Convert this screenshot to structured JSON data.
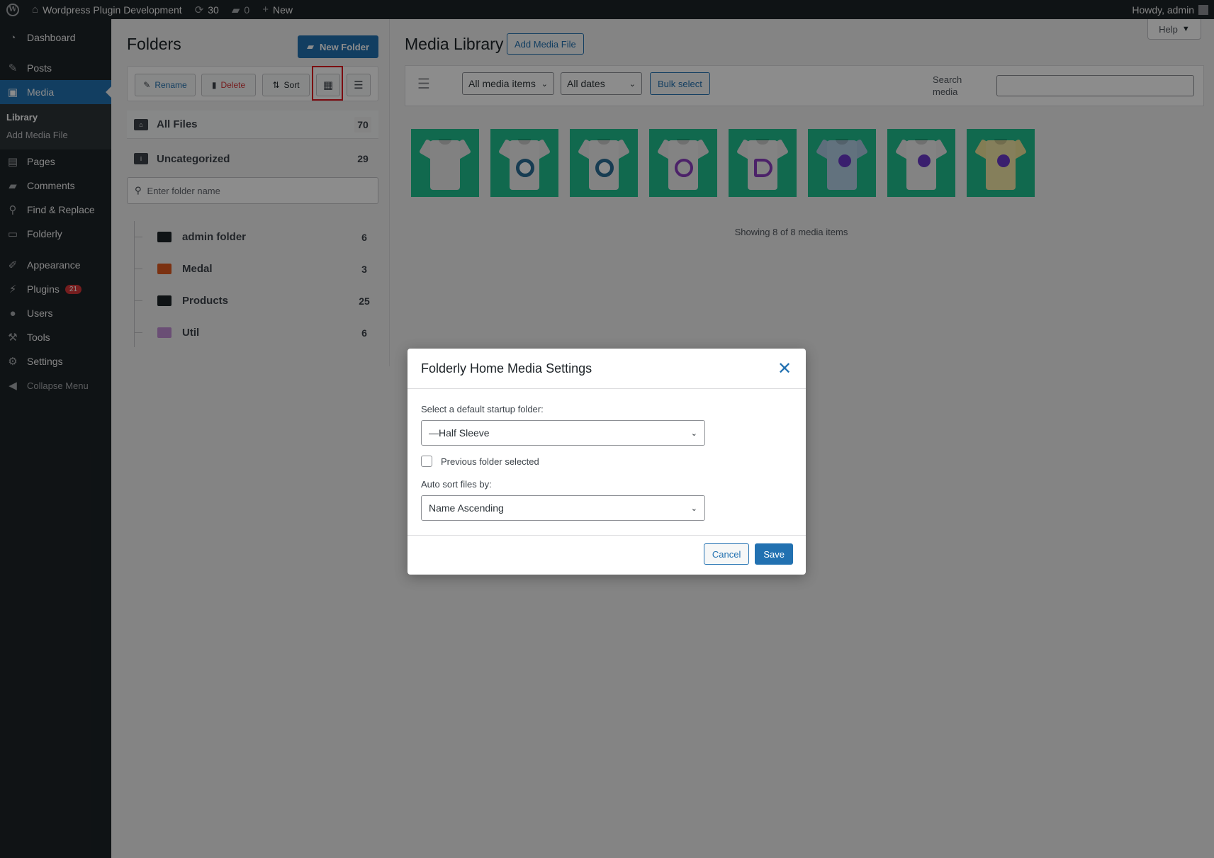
{
  "adminbar": {
    "site_name": "Wordpress Plugin Development",
    "updates_count": "30",
    "comments_count": "0",
    "new_label": "New",
    "greeting": "Howdy, admin"
  },
  "sidebar": {
    "items": [
      {
        "label": "Dashboard",
        "icon": "dashboard-icon"
      },
      {
        "label": "Posts",
        "icon": "pin-icon"
      },
      {
        "label": "Media",
        "icon": "media-icon"
      },
      {
        "label": "Pages",
        "icon": "pages-icon"
      },
      {
        "label": "Comments",
        "icon": "comment-icon"
      },
      {
        "label": "Find & Replace",
        "icon": "search-icon"
      },
      {
        "label": "Folderly",
        "icon": "monitor-icon"
      },
      {
        "label": "Appearance",
        "icon": "brush-icon"
      },
      {
        "label": "Plugins",
        "icon": "plugin-icon"
      },
      {
        "label": "Users",
        "icon": "user-icon"
      },
      {
        "label": "Tools",
        "icon": "wrench-icon"
      },
      {
        "label": "Settings",
        "icon": "settings-icon"
      }
    ],
    "media_sub": [
      "Library",
      "Add Media File"
    ],
    "plugins_badge": "21",
    "collapse_label": "Collapse Menu"
  },
  "folders": {
    "title": "Folders",
    "new_folder_label": "New Folder",
    "rename_label": "Rename",
    "delete_label": "Delete",
    "sort_label": "Sort",
    "all_files": {
      "label": "All Files",
      "count": "70"
    },
    "uncategorized": {
      "label": "Uncategorized",
      "count": "29"
    },
    "search_placeholder": "Enter folder name",
    "tree": [
      {
        "label": "admin folder",
        "count": "6",
        "color": "#1d2327"
      },
      {
        "label": "Medal",
        "count": "3",
        "color": "#e05a1f"
      },
      {
        "label": "Products",
        "count": "25",
        "color": "#1d2327"
      },
      {
        "label": "Util",
        "count": "6",
        "color": "#c18fd6"
      }
    ]
  },
  "media": {
    "help_label": "Help",
    "title": "Media Library",
    "add_label": "Add Media File",
    "type_filter": "All media items",
    "date_filter": "All dates",
    "bulk_label": "Bulk select",
    "search_label": "Search media",
    "showing": "Showing 8 of 8 media items"
  },
  "modal": {
    "title": "Folderly Home Media Settings",
    "startup_label": "Select a default startup folder:",
    "startup_value": "—Half Sleeve",
    "previous_label": "Previous folder selected",
    "sort_label": "Auto sort files by:",
    "sort_value": "Name Ascending",
    "cancel_label": "Cancel",
    "save_label": "Save"
  }
}
